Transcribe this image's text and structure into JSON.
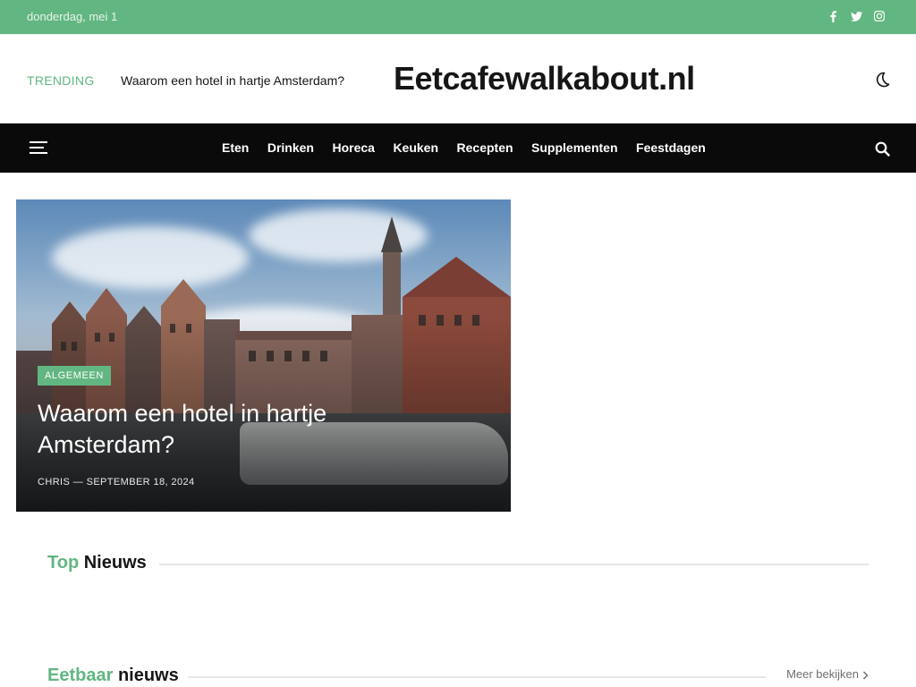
{
  "topbar": {
    "date": "donderdag, mei 1",
    "social": [
      "facebook-icon",
      "twitter-icon",
      "instagram-icon"
    ]
  },
  "header": {
    "trending_label": "TRENDING",
    "trending_link": "Waarom een hotel in hartje Amsterdam?",
    "logo": "Eetcafewalkabout.nl"
  },
  "nav": {
    "items": [
      "Eten",
      "Drinken",
      "Horeca",
      "Keuken",
      "Recepten",
      "Supplementen",
      "Feestdagen"
    ]
  },
  "hero": {
    "category": "ALGEMEEN",
    "title": "Waarom een hotel in hartje Amsterdam?",
    "author": "CHRIS",
    "separator": "—",
    "date": "SEPTEMBER 18, 2024"
  },
  "sections": {
    "top": {
      "accent": "Top",
      "rest": "Nieuws"
    },
    "eetbaar": {
      "accent": "Eetbaar",
      "rest": "nieuws",
      "more": "Meer bekijken"
    }
  },
  "colors": {
    "accent": "#62b681",
    "nav_bg": "#0a0a0a"
  }
}
